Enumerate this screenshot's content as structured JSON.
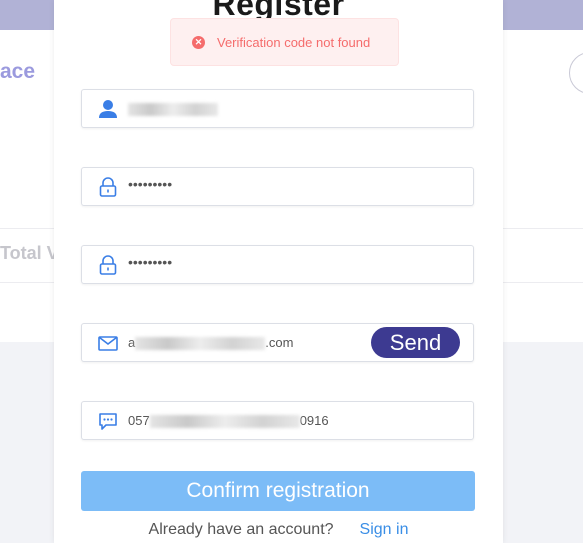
{
  "background": {
    "section_title": "ace",
    "column_header": "Total V"
  },
  "modal": {
    "title": "Register",
    "alert": {
      "icon": "error-circle-icon",
      "message": "Verification code not found"
    },
    "fields": {
      "username": {
        "icon": "user-icon"
      },
      "password": {
        "icon": "lock-icon",
        "value": "•••••••••"
      },
      "confirm_password": {
        "icon": "lock-icon",
        "value": "•••••••••"
      },
      "email": {
        "icon": "mail-icon",
        "value_prefix": "a",
        "value_suffix": ".com"
      },
      "code": {
        "icon": "message-icon",
        "value_prefix": "057",
        "value_suffix": "0916"
      }
    },
    "send_label": "Send",
    "confirm_label": "Confirm registration",
    "footer": {
      "prompt": "Already have an account?",
      "link": "Sign in"
    }
  },
  "colors": {
    "accent": "#3d3a91",
    "confirm": "#7cbcf7",
    "error": "#f56c6c",
    "link": "#3a8ee6"
  }
}
